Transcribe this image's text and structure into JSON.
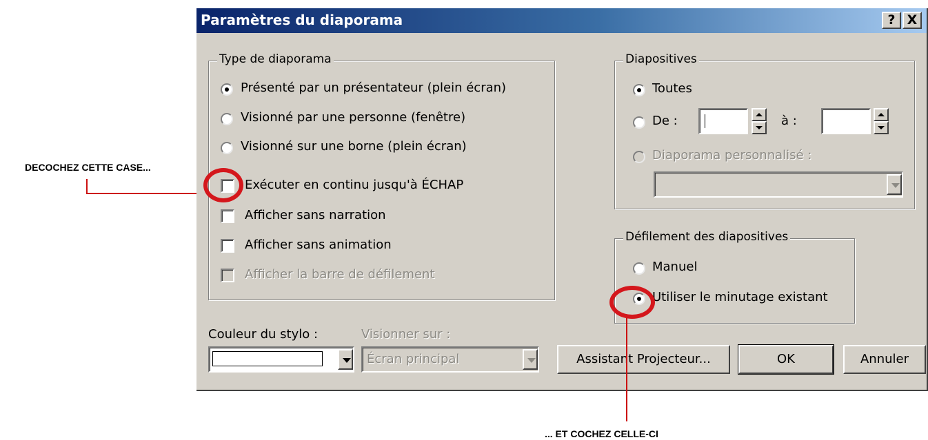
{
  "dialog": {
    "title": "Paramètres du diaporama",
    "help_label": "?",
    "close_label": "X"
  },
  "type_group": {
    "legend": "Type de diaporama",
    "radios": [
      {
        "label": "Présenté par un présentateur (plein écran)",
        "selected": true
      },
      {
        "label": "Visionné par une personne (fenêtre)",
        "selected": false
      },
      {
        "label": "Visionné sur une borne (plein écran)",
        "selected": false
      }
    ],
    "checkboxes": [
      {
        "label": "Exécuter en continu jusqu'à ÉCHAP",
        "checked": false,
        "enabled": true
      },
      {
        "label": "Afficher sans narration",
        "checked": false,
        "enabled": true
      },
      {
        "label": "Afficher sans animation",
        "checked": false,
        "enabled": true
      },
      {
        "label": "Afficher la barre de défilement",
        "checked": false,
        "enabled": false
      }
    ]
  },
  "slides_group": {
    "legend": "Diapositives",
    "all_label": "Toutes",
    "from_label": "De :",
    "to_label": "à :",
    "from_value": "",
    "to_value": "",
    "custom_label": "Diaporama personnalisé :",
    "custom_value": ""
  },
  "advance_group": {
    "legend": "Défilement des diapositives",
    "manual_label": "Manuel",
    "timing_label": "Utiliser le minutage existant",
    "selected": "timing"
  },
  "pen": {
    "label": "Couleur du stylo :",
    "value": ""
  },
  "monitor": {
    "label": "Visionner sur :",
    "value": "Écran principal"
  },
  "buttons": {
    "projector": "Assistant Projecteur...",
    "ok": "OK",
    "cancel": "Annuler"
  },
  "annotations": {
    "left": "DECOCHEZ CETTE CASE...",
    "bottom": "... ET COCHEZ CELLE-CI",
    "color": "#d4171c"
  }
}
